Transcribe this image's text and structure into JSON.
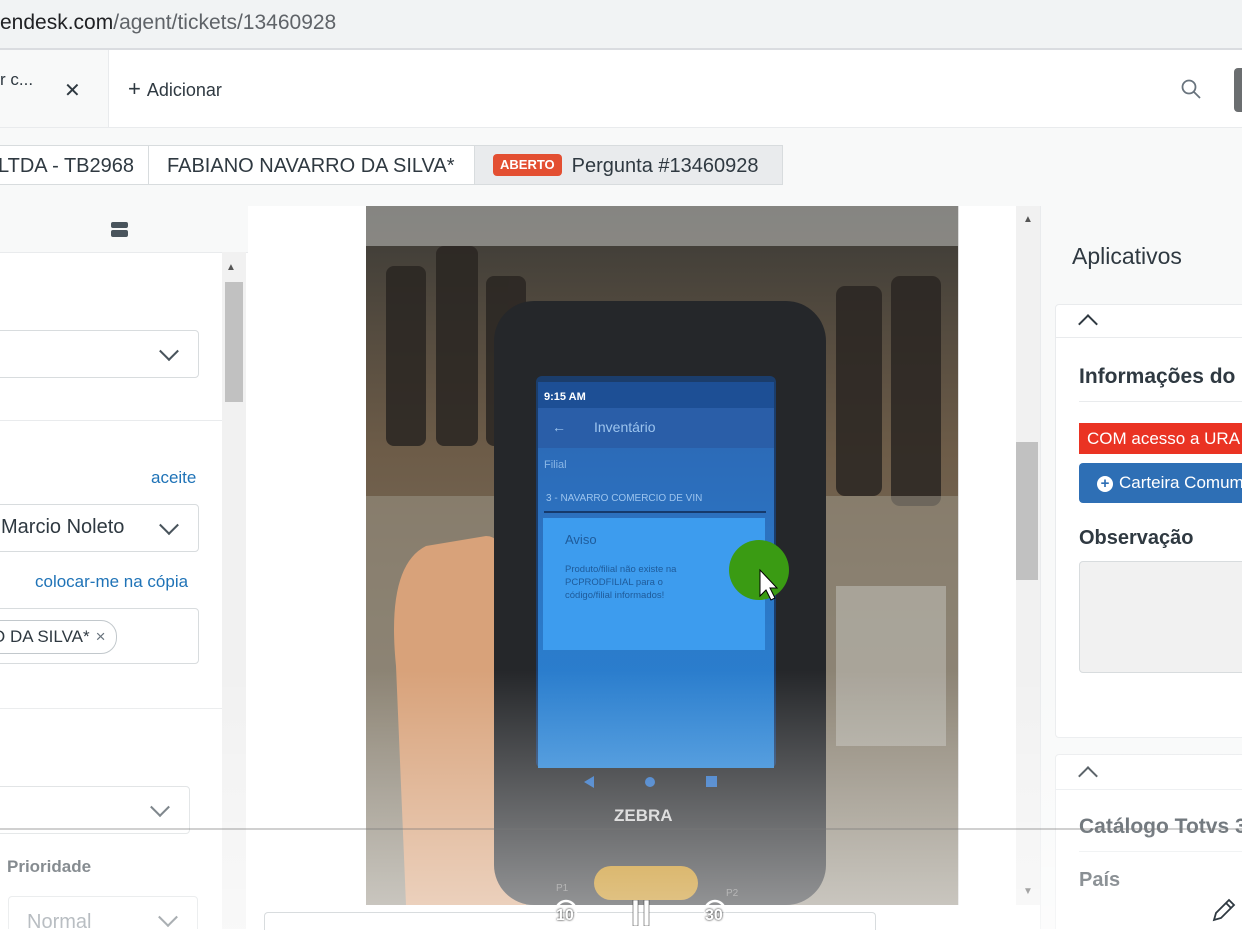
{
  "browser": {
    "url_domain": "endesk.com",
    "url_path": "/agent/tickets/13460928"
  },
  "tabs": {
    "active_label": "r c...",
    "add_label": "Adicionar"
  },
  "breadcrumbs": {
    "org": "LTDA - TB2968",
    "requester": "FABIANO NAVARRO DA SILVA*",
    "status_badge": "ABERTO",
    "ticket": "Pergunta #13460928"
  },
  "left_panel": {
    "accept_link": "aceite",
    "assignee_value": "Marcio Noleto",
    "cc_link": "colocar-me na cópia",
    "cc_tag": "O DA SILVA*",
    "cc_remove": "×",
    "priority_label": "Prioridade",
    "priority_value": "Normal"
  },
  "video": {
    "phone_time": "9:15 AM",
    "phone_app_title": "Inventário",
    "phone_field_label": "Filial",
    "phone_field_value": "3 - NAVARRO COMERCIO DE VIN",
    "dialog_title": "Aviso",
    "dialog_message": "Produto/filial não existe na PCPRODFILIAL para o código/filial informados!",
    "phone_brand": "ZEBRA",
    "key_p1": "P1",
    "key_p2": "P2",
    "rewind_seconds": "10",
    "forward_seconds": "30"
  },
  "right_panel": {
    "title": "Aplicativos",
    "info_title": "Informações do",
    "ura_badge": "COM acesso a URA",
    "carteira_button": "Carteira Comum",
    "observacao_label": "Observação",
    "catalog_title": "Catálogo Totvs 3",
    "pais_label": "País"
  },
  "colors": {
    "status_badge": "#e34f32",
    "ura_badge": "#ea3323",
    "carteira_button": "#2e6fb5",
    "link": "#1f73b7"
  }
}
